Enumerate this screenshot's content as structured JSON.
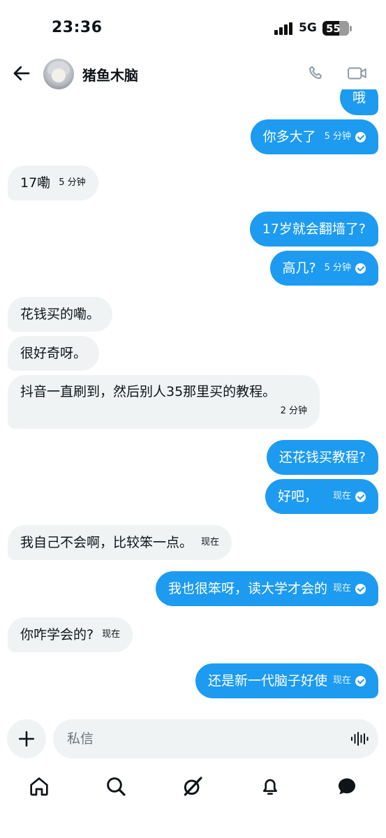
{
  "status_bar": {
    "time": "23:36",
    "network": "5G",
    "battery": "55"
  },
  "header": {
    "contact_name": "猪鱼木脑",
    "icons": [
      "back-arrow-icon",
      "avatar",
      "phone-icon",
      "video-icon"
    ]
  },
  "messages": [
    {
      "direction": "out",
      "text": "哦",
      "time": "",
      "read": false
    },
    {
      "direction": "out",
      "text": "你多大了",
      "time": "5 分钟",
      "read": true
    },
    {
      "direction": "in",
      "text": "17嘞",
      "time": "5 分钟"
    },
    {
      "direction": "out",
      "text": "17岁就会翻墙了?",
      "time": "",
      "read": false
    },
    {
      "direction": "out",
      "text": "高几?",
      "time": "5 分钟",
      "read": true
    },
    {
      "direction": "in",
      "text": "花钱买的嘞。",
      "time": ""
    },
    {
      "direction": "in",
      "text": "很好奇呀。",
      "time": ""
    },
    {
      "direction": "in",
      "text": "抖音一直刷到，然后别人35那里买的教程。",
      "time": "2 分钟"
    },
    {
      "direction": "out",
      "text": "还花钱买教程?",
      "time": "",
      "read": false
    },
    {
      "direction": "out",
      "text": "好吧，",
      "time": "现在",
      "read": true
    },
    {
      "direction": "in",
      "text": "我自己不会啊，比较笨一点。",
      "time": "现在"
    },
    {
      "direction": "out",
      "text": "我也很笨呀，读大学才会的",
      "time": "现在",
      "read": true
    },
    {
      "direction": "in",
      "text": "你咋学会的?",
      "time": "现在"
    },
    {
      "direction": "out",
      "text": "还是新一代脑子好使",
      "time": "现在",
      "read": true
    }
  ],
  "composer": {
    "placeholder": "私信"
  },
  "tabbar": {
    "items": [
      "home-icon",
      "search-icon",
      "grok-icon",
      "notifications-icon",
      "messages-icon"
    ]
  }
}
